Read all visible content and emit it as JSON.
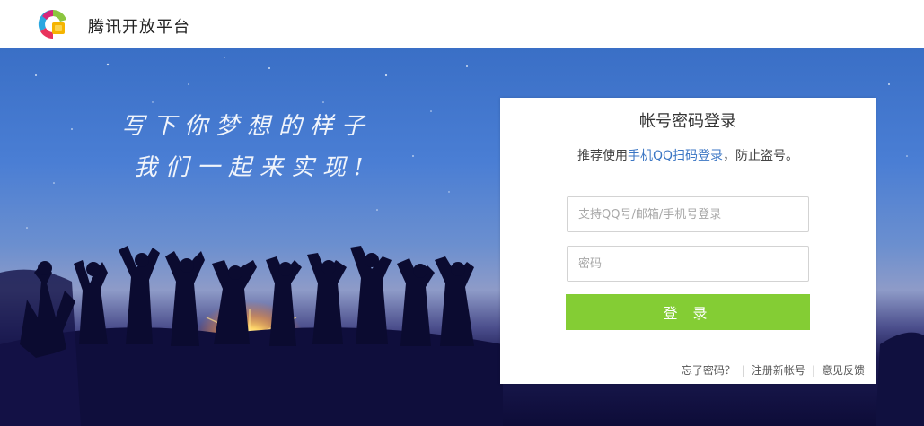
{
  "header": {
    "brand": "腾讯开放平台",
    "logo_icon": "tencent-open-platform-logo-icon"
  },
  "banner": {
    "slogan_line1": "写下你梦想的样子",
    "slogan_line2": "我们一起来实现!"
  },
  "login": {
    "title": "帐号密码登录",
    "tip_prefix": "推荐使用",
    "tip_link": "手机QQ扫码登录",
    "tip_suffix": "，防止盗号。",
    "username_placeholder": "支持QQ号/邮箱/手机号登录",
    "password_placeholder": "密码",
    "submit_label": "登 录",
    "forgot_password": "忘了密码？",
    "register": "注册新帐号",
    "feedback": "意见反馈",
    "separator": "|"
  },
  "colors": {
    "accent_green": "#84cd34",
    "link_blue": "#3b76c4"
  }
}
